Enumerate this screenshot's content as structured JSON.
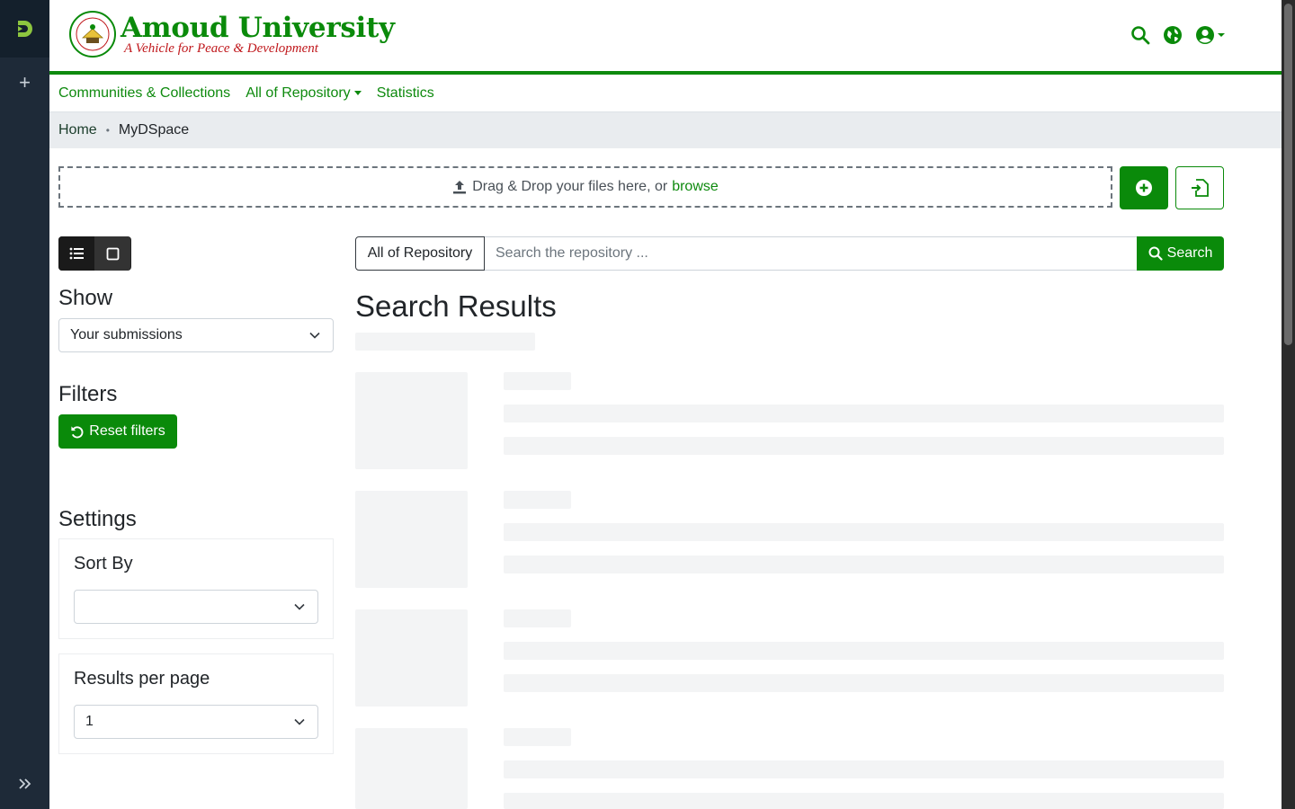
{
  "header": {
    "brand_name": "Amoud University",
    "brand_tagline": "A Vehicle for Peace & Development",
    "icons": [
      "search-icon",
      "globe-icon",
      "user-circle-icon"
    ]
  },
  "nav": {
    "items": [
      {
        "label": "Communities & Collections"
      },
      {
        "label": "All of Repository"
      },
      {
        "label": "Statistics"
      }
    ]
  },
  "breadcrumb": {
    "home": "Home",
    "current": "MyDSpace"
  },
  "upload": {
    "text": "Drag & Drop your files here, or",
    "browse": "browse"
  },
  "sidebar": {
    "show_title": "Show",
    "show_value": "Your submissions",
    "filters_title": "Filters",
    "reset_label": "Reset filters",
    "settings_title": "Settings",
    "sort_by_title": "Sort By",
    "sort_by_value": "",
    "results_per_page_title": "Results per page",
    "results_per_page_value": "1"
  },
  "search": {
    "scope": "All of Repository",
    "placeholder": "Search the repository ...",
    "button_label": "Search"
  },
  "results": {
    "title": "Search Results",
    "loading_placeholders": 4
  },
  "colors": {
    "brand_green": "#0a8a0a",
    "rail_dark": "#1e2a38",
    "tagline_red": "#c0181c"
  }
}
